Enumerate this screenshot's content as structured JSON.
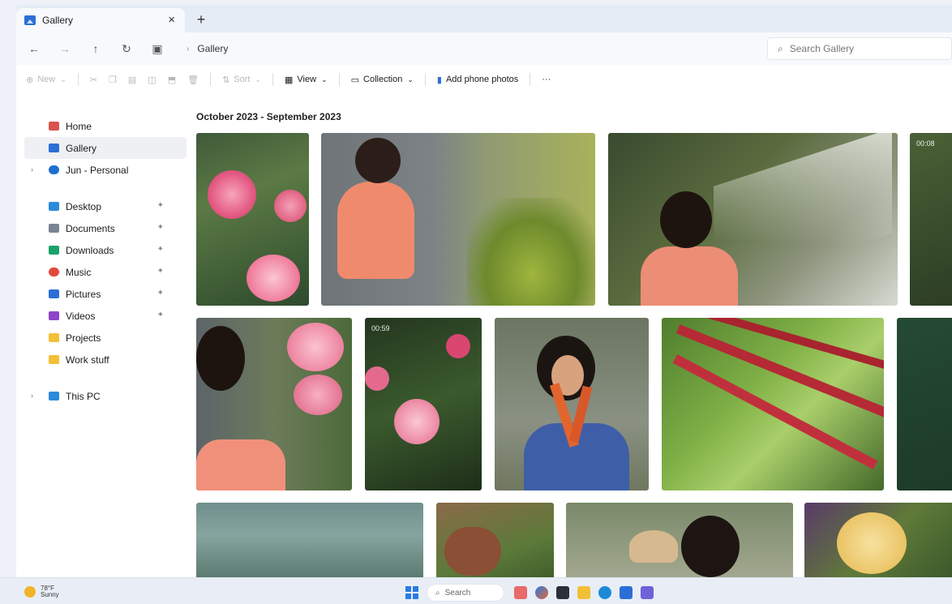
{
  "window": {
    "tab_title": "Gallery",
    "tab_close": "×",
    "new_tab": "+"
  },
  "address": {
    "breadcrumb_sep": "›",
    "breadcrumb_current": "Gallery",
    "search_placeholder": "Search Gallery"
  },
  "toolbar": {
    "new_label": "New",
    "sort_label": "Sort",
    "view_label": "View",
    "collection_label": "Collection",
    "add_phone_label": "Add phone photos",
    "more_label": "···"
  },
  "sidebar": {
    "items": [
      {
        "label": "Home",
        "color": "#d9534f"
      },
      {
        "label": "Gallery",
        "color": "#2b6fd6"
      },
      {
        "label": "Jun - Personal",
        "color": "#1f6fd1"
      },
      {
        "label": "Desktop",
        "color": "#2b8ad9"
      },
      {
        "label": "Documents",
        "color": "#7a8593"
      },
      {
        "label": "Downloads",
        "color": "#1aa36b"
      },
      {
        "label": "Music",
        "color": "#e0493c"
      },
      {
        "label": "Pictures",
        "color": "#2b6fd6"
      },
      {
        "label": "Videos",
        "color": "#8e44c9"
      },
      {
        "label": "Projects",
        "color": "#f2c037"
      },
      {
        "label": "Work stuff",
        "color": "#f2c037"
      },
      {
        "label": "This PC",
        "color": "#2b8ad9"
      }
    ]
  },
  "gallery": {
    "date_heading": "October 2023 - September 2023",
    "durations": [
      "00:08",
      "00:59"
    ]
  },
  "taskbar": {
    "temp": "78°F",
    "condition": "Sunny",
    "search_label": "Search"
  }
}
